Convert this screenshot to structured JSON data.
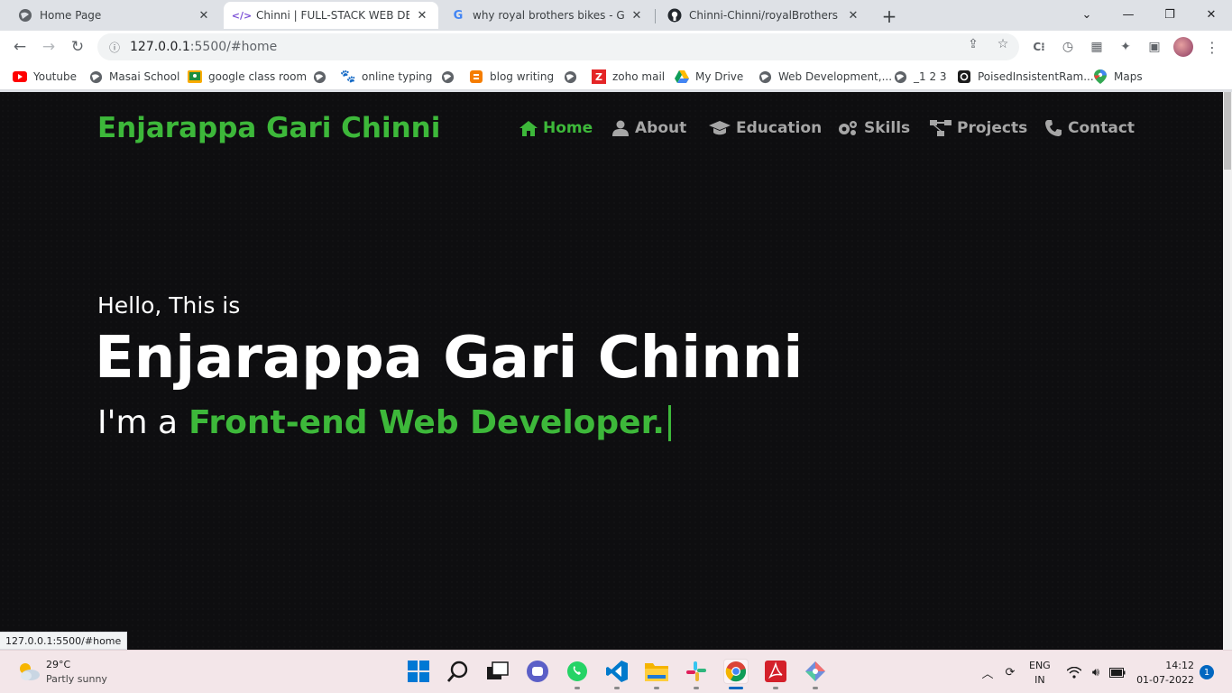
{
  "browser": {
    "tabs": [
      {
        "title": "Home Page",
        "active": false
      },
      {
        "title": "Chinni | FULL-STACK WEB DEVELO",
        "active": true
      },
      {
        "title": "why royal brothers bikes - Googl",
        "active": false
      },
      {
        "title": "Chinni-Chinni/royalBrothers",
        "active": false
      }
    ],
    "new_tab_label": "+",
    "url_host": "127.0.0.1",
    "url_path": ":5500/#home",
    "bookmarks": [
      {
        "label": "Youtube",
        "icon": "youtube-icon"
      },
      {
        "label": "Masai School",
        "icon": "globe-icon"
      },
      {
        "label": "google class room",
        "icon": "classroom-icon"
      },
      {
        "label": "online typing",
        "icon": "paw-icon"
      },
      {
        "label": "blog writing",
        "icon": "blogger-icon"
      },
      {
        "label": "zoho mail",
        "icon": "zoho-icon"
      },
      {
        "label": "My Drive",
        "icon": "drive-icon"
      },
      {
        "label": "Web Development,...",
        "icon": "globe-icon"
      },
      {
        "label": "_1 2 3",
        "icon": "globe-icon"
      },
      {
        "label": "PoisedInsistentRam...",
        "icon": "replit-icon"
      },
      {
        "label": "Maps",
        "icon": "maps-icon"
      }
    ],
    "status_url": "127.0.0.1:5500/#home"
  },
  "site": {
    "brand": "Enjarappa Gari Chinni",
    "nav": [
      {
        "label": "Home",
        "icon": "home-icon",
        "active": true
      },
      {
        "label": "About",
        "icon": "user-icon",
        "active": false
      },
      {
        "label": "Education",
        "icon": "graduation-cap-icon",
        "active": false
      },
      {
        "label": "Skills",
        "icon": "gears-icon",
        "active": false
      },
      {
        "label": "Projects",
        "icon": "project-diagram-icon",
        "active": false
      },
      {
        "label": "Contact",
        "icon": "phone-icon",
        "active": false
      }
    ],
    "hero": {
      "greeting": "Hello, This is",
      "name": "Enjarappa Gari Chinni",
      "role_prefix": "I'm a",
      "role_highlight": "Front-end Web Developer."
    },
    "colors": {
      "accent": "#3db83a",
      "background": "#0e0e10",
      "nav_text": "#a6a6a6"
    }
  },
  "taskbar": {
    "weather_temp": "29°C",
    "weather_desc": "Partly sunny",
    "apps": [
      "windows-start-icon",
      "search-icon",
      "task-view-icon",
      "teams-chat-icon",
      "whatsapp-icon",
      "vscode-icon",
      "file-explorer-icon",
      "slack-icon",
      "chrome-icon",
      "acrobat-icon",
      "git-tool-icon"
    ],
    "lang_line1": "ENG",
    "lang_line2": "IN",
    "time": "14:12",
    "date": "01-07-2022",
    "notifications": "1"
  }
}
